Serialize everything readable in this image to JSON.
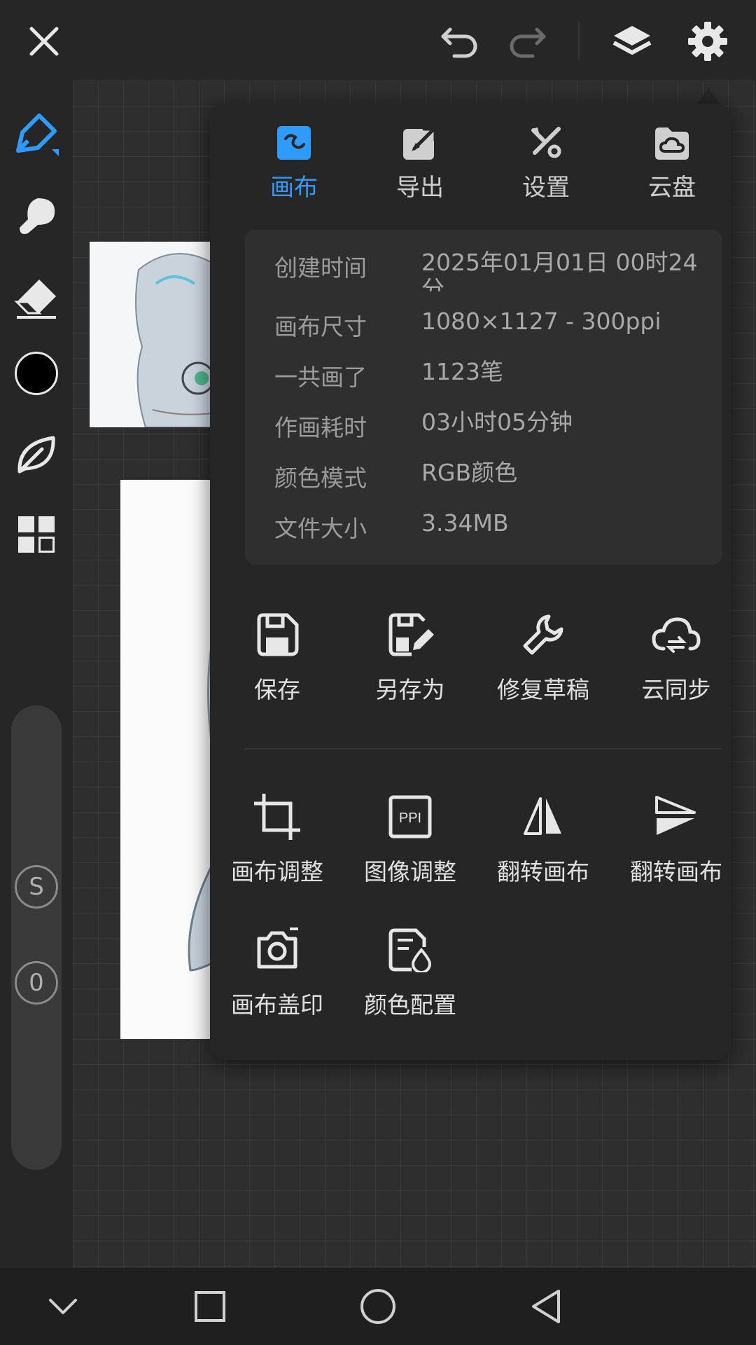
{
  "panel": {
    "tabs": [
      {
        "label": "画布",
        "icon": "canvas-icon",
        "active": true
      },
      {
        "label": "导出",
        "icon": "export-icon",
        "active": false
      },
      {
        "label": "设置",
        "icon": "tools-icon",
        "active": false
      },
      {
        "label": "云盘",
        "icon": "cloud-folder-icon",
        "active": false
      }
    ],
    "info": [
      {
        "key": "创建时间",
        "value": "2025年01月01日 00时24分"
      },
      {
        "key": "画布尺寸",
        "value": "1080×1127 - 300ppi"
      },
      {
        "key": "一共画了",
        "value": "1123笔"
      },
      {
        "key": "作画耗时",
        "value": "03小时05分钟"
      },
      {
        "key": "颜色模式",
        "value": "RGB颜色"
      },
      {
        "key": "文件大小",
        "value": "3.34MB"
      }
    ],
    "actions_row1": [
      {
        "label": "保存",
        "icon": "save-icon"
      },
      {
        "label": "另存为",
        "icon": "save-as-icon"
      },
      {
        "label": "修复草稿",
        "icon": "wrench-icon"
      },
      {
        "label": "云同步",
        "icon": "cloud-sync-icon"
      }
    ],
    "actions_row2": [
      {
        "label": "画布调整",
        "icon": "crop-icon"
      },
      {
        "label": "图像调整",
        "icon": "ppi-icon"
      },
      {
        "label": "翻转画布",
        "icon": "flip-horizontal-icon"
      },
      {
        "label": "翻转画布",
        "icon": "flip-vertical-icon"
      }
    ],
    "actions_row3": [
      {
        "label": "画布盖印",
        "icon": "camera-icon"
      },
      {
        "label": "颜色配置",
        "icon": "color-config-icon"
      }
    ]
  },
  "sidebar": {
    "badges": [
      "S",
      "0"
    ]
  },
  "colors": {
    "accent": "#2f9bff",
    "current_color": "#000000"
  }
}
